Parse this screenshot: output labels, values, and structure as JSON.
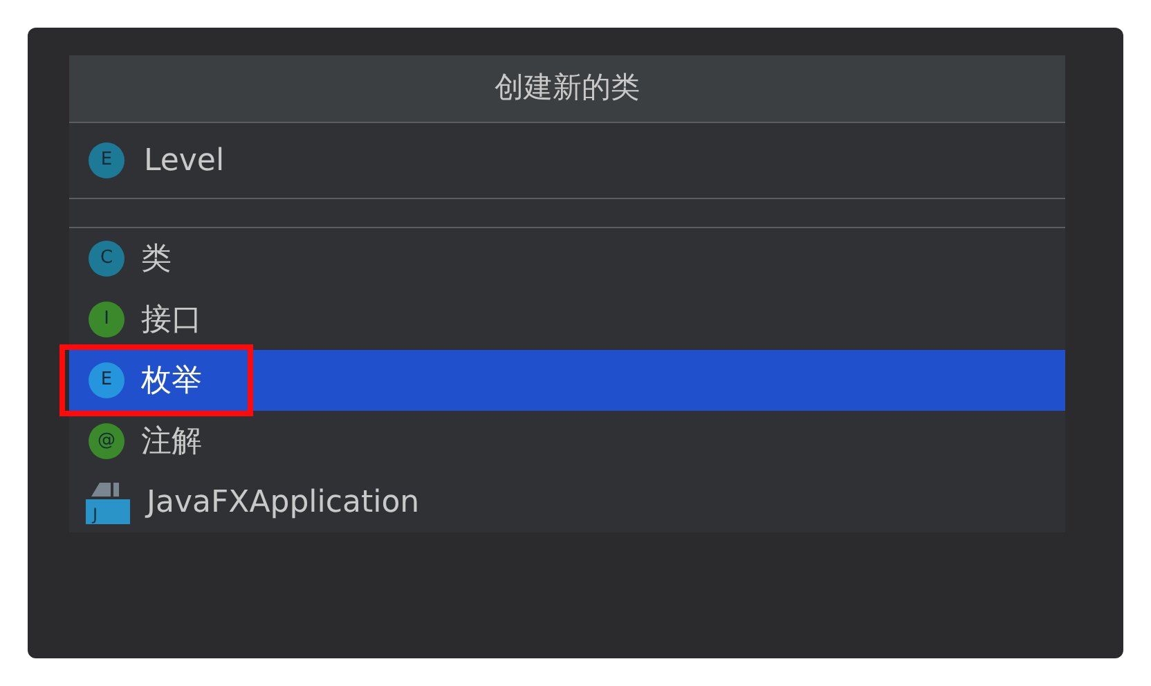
{
  "dialog": {
    "title": "创建新的类"
  },
  "name_field": {
    "badge": "E",
    "kind": "enum",
    "value": "Level"
  },
  "items": [
    {
      "badge": "C",
      "kind": "class",
      "label": "类",
      "selected": false,
      "highlighted": false
    },
    {
      "badge": "I",
      "kind": "interface",
      "label": "接口",
      "selected": false,
      "highlighted": false
    },
    {
      "badge": "E",
      "kind": "enum",
      "label": "枚举",
      "selected": true,
      "highlighted": true
    },
    {
      "badge": "@",
      "kind": "annotation",
      "label": "注解",
      "selected": false,
      "highlighted": false
    },
    {
      "badge": "J",
      "kind": "javafx",
      "label": "JavaFXApplication",
      "selected": false,
      "highlighted": false
    }
  ]
}
